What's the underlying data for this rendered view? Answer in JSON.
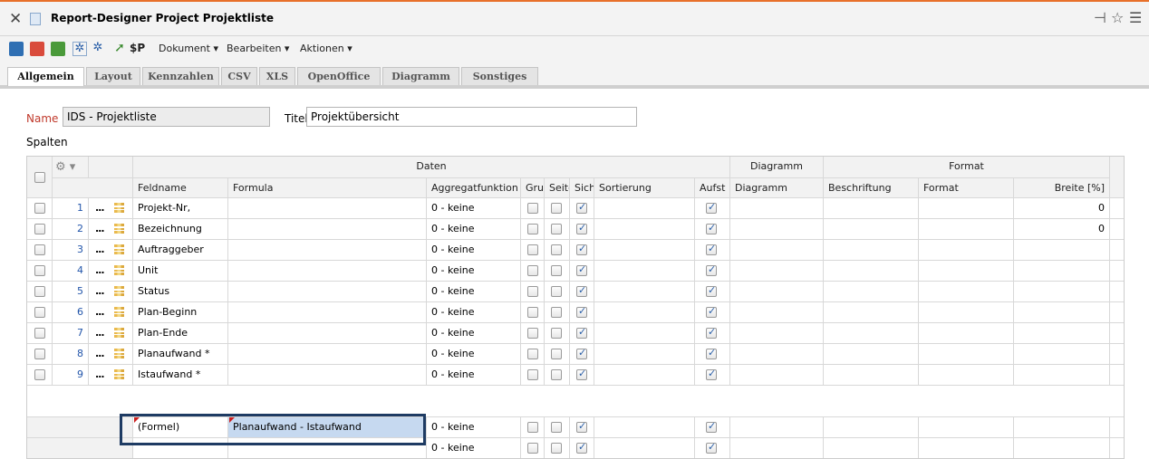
{
  "window": {
    "title": "Report-Designer Project Projektliste",
    "icons": [
      "close-icon",
      "document-icon",
      "pin-icon",
      "star-icon",
      "menu-icon"
    ]
  },
  "toolbar": {
    "menus": [
      "Dokument",
      "Bearbeiten",
      "Aktionen"
    ],
    "sp_label": "$P"
  },
  "tabs": [
    "Allgemein",
    "Layout",
    "Kennzahlen",
    "CSV",
    "XLS",
    "OpenOffice",
    "Diagramm",
    "Sonstiges"
  ],
  "form": {
    "name_label": "Name",
    "name_value": "IDS - Projektliste",
    "title_label": "Titel",
    "title_value": "Projektübersicht",
    "columns_label": "Spalten"
  },
  "table": {
    "group_headers": {
      "daten": "Daten",
      "diagramm": "Diagramm",
      "format": "Format"
    },
    "columns": [
      "Feldname",
      "Formula",
      "Aggregatfunktion",
      "Grup",
      "Seite",
      "Sicht",
      "Sortierung",
      "Aufst",
      "Diagramm",
      "Beschriftung",
      "Format",
      "Breite [%]"
    ],
    "rows": [
      {
        "n": "1",
        "feld": "Projekt-Nr,",
        "agg": "0 - keine",
        "sicht": true,
        "aufst": true,
        "breite": "0"
      },
      {
        "n": "2",
        "feld": "Bezeichnung",
        "agg": "0 - keine",
        "sicht": true,
        "aufst": true,
        "breite": "0"
      },
      {
        "n": "3",
        "feld": "Auftraggeber",
        "agg": "0 - keine",
        "sicht": true,
        "aufst": true,
        "breite": ""
      },
      {
        "n": "4",
        "feld": "Unit",
        "agg": "0 - keine",
        "sicht": true,
        "aufst": true,
        "breite": ""
      },
      {
        "n": "5",
        "feld": "Status",
        "agg": "0 - keine",
        "sicht": true,
        "aufst": true,
        "breite": ""
      },
      {
        "n": "6",
        "feld": "Plan-Beginn",
        "agg": "0 - keine",
        "sicht": true,
        "aufst": true,
        "breite": ""
      },
      {
        "n": "7",
        "feld": "Plan-Ende",
        "agg": "0 - keine",
        "sicht": true,
        "aufst": true,
        "breite": ""
      },
      {
        "n": "8",
        "feld": "Planaufwand *",
        "agg": "0 - keine",
        "sicht": true,
        "aufst": true,
        "breite": ""
      },
      {
        "n": "9",
        "feld": "Istaufwand *",
        "agg": "0 - keine",
        "sicht": true,
        "aufst": true,
        "breite": ""
      }
    ],
    "new_rows": [
      {
        "feld": "(Formel)",
        "formula": "Planaufwand - Istaufwand",
        "agg": "0 - keine"
      },
      {
        "feld": "",
        "formula": "",
        "agg": "0 - keine"
      }
    ]
  },
  "colors": {
    "accent": "#e8702a",
    "selection_border": "#1e3b63",
    "selection_fill": "#c6d9f0",
    "name_label": "#c0392b"
  }
}
